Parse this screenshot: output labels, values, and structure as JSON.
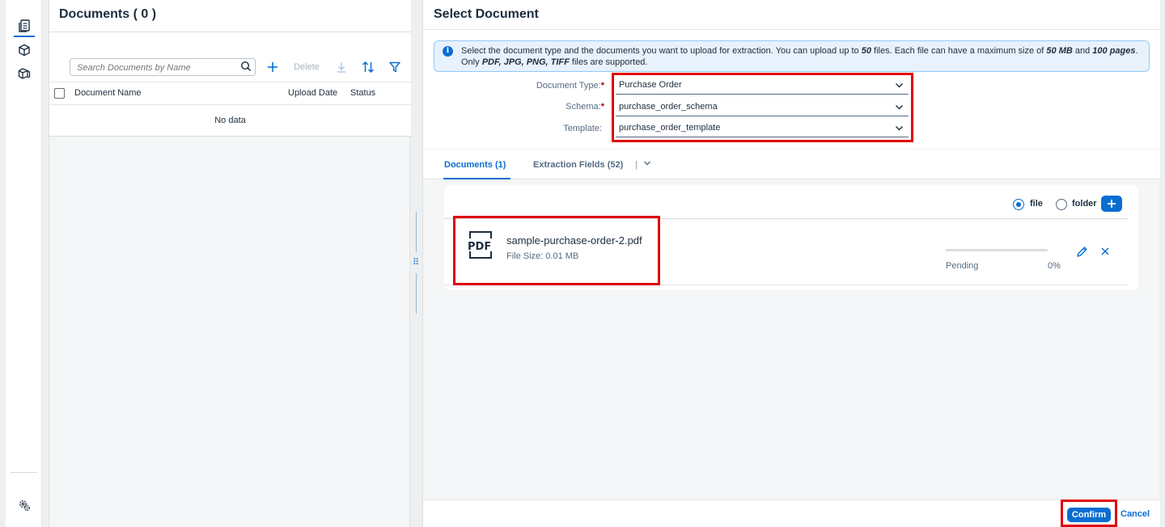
{
  "nav": {
    "items": [
      {
        "icon": "documents-icon"
      },
      {
        "icon": "cube-icon"
      },
      {
        "icon": "cubes-icon"
      }
    ],
    "bottom_icon": "settings-icon"
  },
  "documents_panel": {
    "title": "Documents ( 0 )",
    "search_placeholder": "Search Documents by Name",
    "delete_label": "Delete",
    "columns": [
      "Document Name",
      "Upload Date",
      "Status"
    ],
    "empty_text": "No data"
  },
  "select_panel": {
    "title": "Select Document",
    "info": {
      "p1": "Select the document type and the documents you want to upload for extraction. You can upload up to ",
      "max_files": "50",
      "p2": " files. Each file can have a maximum size of ",
      "max_size": "50 MB",
      "p3": " and ",
      "max_pages": "100 pages",
      "p4": ". Only ",
      "formats": "PDF, JPG, PNG, TIFF",
      "p5": " files are supported."
    },
    "form": {
      "document_type_label": "Document Type:",
      "document_type_value": "Purchase Order",
      "schema_label": "Schema:",
      "schema_value": "purchase_order_schema",
      "template_label": "Template:",
      "template_value": "purchase_order_template",
      "required_mark": "*"
    },
    "tabs": [
      {
        "label": "Documents (1)",
        "active": true
      },
      {
        "label": "Extraction Fields (52)",
        "active": false
      }
    ],
    "upload": {
      "radio_file": "file",
      "radio_folder": "folder",
      "selected": "file",
      "file": {
        "icon_text": "PDF",
        "name": "sample-purchase-order-2.pdf",
        "size": "File Size: 0.01 MB",
        "status": "Pending",
        "progress_pct": "0%",
        "progress": 0
      }
    },
    "footer": {
      "confirm_label": "Confirm",
      "cancel_label": "Cancel"
    }
  },
  "colors": {
    "accent": "#0a6ed1",
    "highlight": "#e0000c"
  }
}
